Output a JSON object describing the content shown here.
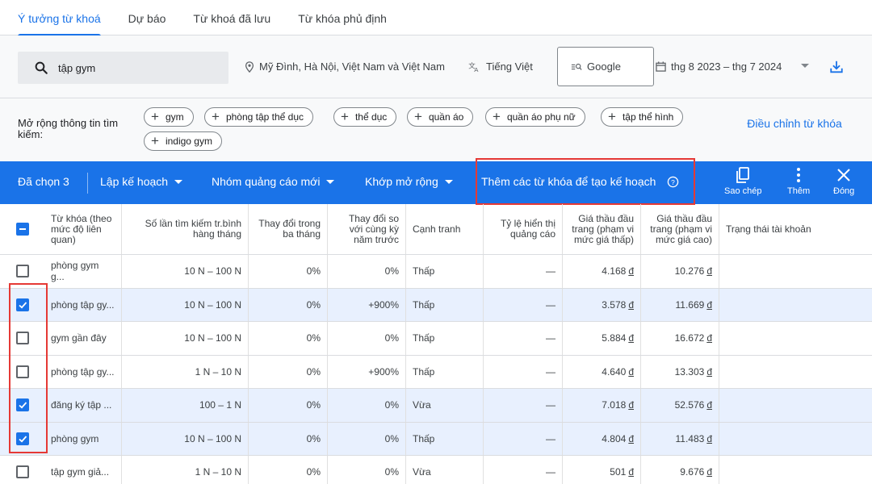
{
  "tabs": [
    {
      "label": "Ý tưởng từ khoá",
      "active": true
    },
    {
      "label": "Dự báo",
      "active": false
    },
    {
      "label": "Từ khoá đã lưu",
      "active": false
    },
    {
      "label": "Từ khóa phủ định",
      "active": false
    }
  ],
  "search": {
    "value": "tập gym",
    "location": "Mỹ Đình, Hà Nội, Việt Nam và Việt Nam",
    "language": "Tiếng Việt",
    "network": "Google",
    "date_range": "thg 8 2023 – thg 7 2024"
  },
  "expand": {
    "label": "Mở rộng thông tin tìm kiếm:",
    "chips": [
      "gym",
      "phòng tập thể dục",
      "thể dục",
      "quần áo",
      "quần áo phụ nữ",
      "tập thể hình",
      "indigo gym"
    ],
    "refine_label": "Điều chỉnh từ khóa"
  },
  "toolbar": {
    "selected_count": "Đã chọn 3",
    "plan_label": "Lập kế hoạch",
    "new_ad_group_label": "Nhóm quảng cáo mới",
    "broad_match_label": "Khớp mở rộng",
    "add_keywords_label": "Thêm các từ khóa để tạo kế hoạch",
    "copy_label": "Sao chép",
    "more_label": "Thêm",
    "close_label": "Đóng"
  },
  "table": {
    "headers": {
      "keyword": "Từ khóa (theo mức độ liên quan)",
      "avg_searches": "Số lần tìm kiếm tr.bình hàng tháng",
      "three_month": "Thay đổi trong ba tháng",
      "yoy": "Thay đổi so với cùng kỳ năm trước",
      "competition": "Cạnh tranh",
      "impression_share": "Tỷ lệ hiển thị quảng cáo",
      "bid_low": "Giá thầu đầu trang (phạm vi mức giá thấp)",
      "bid_high": "Giá thầu đầu trang (phạm vi mức giá cao)",
      "account_status": "Trạng thái tài khoản"
    },
    "rows": [
      {
        "keyword": "phòng gym g...",
        "avg": "10 N – 100 N",
        "three": "0%",
        "yoy": "0%",
        "comp": "Thấp",
        "share": "—",
        "low": "4.168",
        "high": "10.276",
        "checked": false
      },
      {
        "keyword": "phòng tập gy...",
        "avg": "10 N – 100 N",
        "three": "0%",
        "yoy": "+900%",
        "comp": "Thấp",
        "share": "—",
        "low": "3.578",
        "high": "11.669",
        "checked": true
      },
      {
        "keyword": "gym gần đây",
        "avg": "10 N – 100 N",
        "three": "0%",
        "yoy": "0%",
        "comp": "Thấp",
        "share": "—",
        "low": "5.884",
        "high": "16.672",
        "checked": false
      },
      {
        "keyword": "phòng tập gy...",
        "avg": "1 N – 10 N",
        "three": "0%",
        "yoy": "+900%",
        "comp": "Thấp",
        "share": "—",
        "low": "4.640",
        "high": "13.303",
        "checked": false
      },
      {
        "keyword": "đăng ký tập ...",
        "avg": "100 – 1 N",
        "three": "0%",
        "yoy": "0%",
        "comp": "Vừa",
        "share": "—",
        "low": "7.018",
        "high": "52.576",
        "checked": true
      },
      {
        "keyword": "phòng gym",
        "avg": "10 N – 100 N",
        "three": "0%",
        "yoy": "0%",
        "comp": "Thấp",
        "share": "—",
        "low": "4.804",
        "high": "11.483",
        "checked": true
      },
      {
        "keyword": "tập gym giả...",
        "avg": "1 N – 10 N",
        "three": "0%",
        "yoy": "0%",
        "comp": "Vừa",
        "share": "—",
        "low": "501",
        "high": "9.676",
        "checked": false
      }
    ],
    "currency": "đ"
  },
  "colors": {
    "accent": "#1a73e8",
    "highlight_border": "#e53935",
    "selected_row": "#e8f0fe"
  }
}
